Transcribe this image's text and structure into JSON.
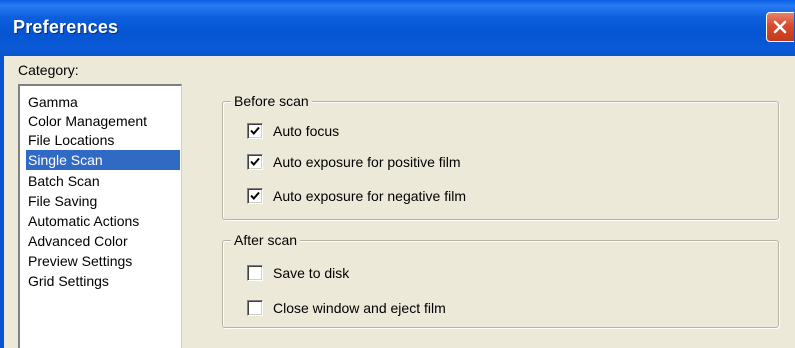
{
  "window": {
    "title": "Preferences"
  },
  "category": {
    "label": "Category:",
    "items": [
      {
        "label": "Gamma",
        "selected": false
      },
      {
        "label": "Color Management",
        "selected": false
      },
      {
        "label": "File Locations",
        "selected": false
      },
      {
        "label": "Single Scan",
        "selected": true
      },
      {
        "label": "Batch Scan",
        "selected": false
      },
      {
        "label": "File Saving",
        "selected": false
      },
      {
        "label": "Automatic Actions",
        "selected": false
      },
      {
        "label": "Advanced Color",
        "selected": false
      },
      {
        "label": "Preview Settings",
        "selected": false
      },
      {
        "label": "Grid Settings",
        "selected": false
      }
    ]
  },
  "before_scan": {
    "legend": "Before scan",
    "options": [
      {
        "label": "Auto focus",
        "checked": true
      },
      {
        "label": "Auto exposure for positive film",
        "checked": true
      },
      {
        "label": "Auto exposure for negative film",
        "checked": true
      }
    ]
  },
  "after_scan": {
    "legend": "After scan",
    "options": [
      {
        "label": "Save to disk",
        "checked": false
      },
      {
        "label": "Close window and eject film",
        "checked": false
      }
    ]
  },
  "icons": {
    "close": "close-icon",
    "check": "checkmark-icon"
  },
  "colors": {
    "titlebar": "#0554d2",
    "selection": "#316ac5",
    "close_button": "#d84a2c",
    "dialog_bg": "#ece9d8"
  }
}
